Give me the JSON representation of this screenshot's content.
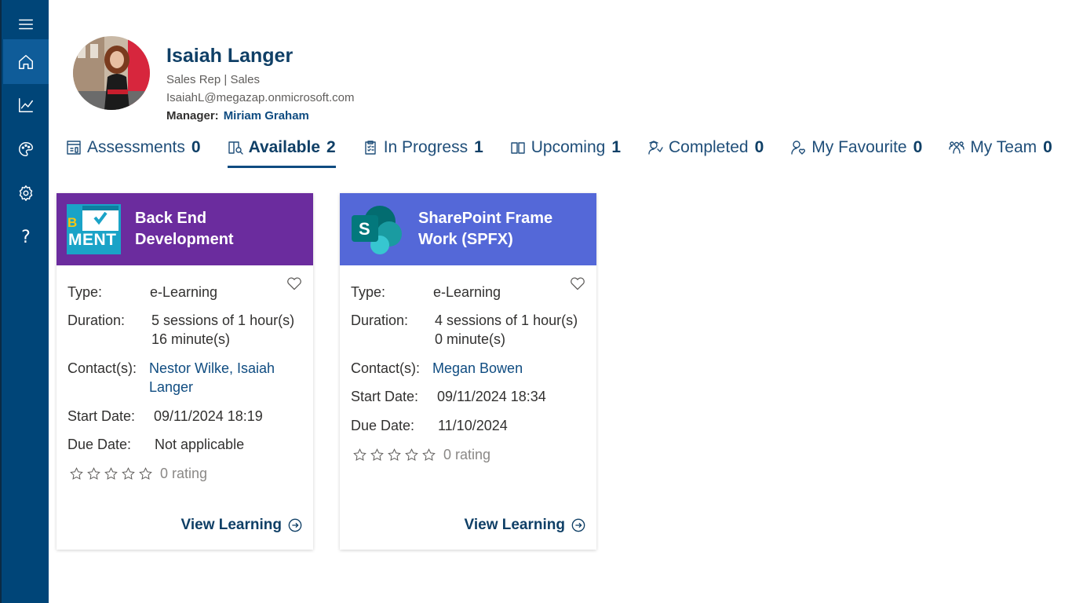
{
  "sidebar": {
    "items": [
      {
        "icon": "hamburger-menu-icon"
      },
      {
        "icon": "home-icon",
        "active": true
      },
      {
        "icon": "chart-line-icon"
      },
      {
        "icon": "palette-icon"
      },
      {
        "icon": "gear-icon"
      },
      {
        "icon": "help-icon",
        "glyph": "?"
      }
    ]
  },
  "profile": {
    "name": "Isaiah Langer",
    "role": "Sales Rep | Sales",
    "email": "IsaiahL@megazap.onmicrosoft.com",
    "manager_label": "Manager:",
    "manager_name": "Miriam Graham"
  },
  "tabs": [
    {
      "label": "Assessments",
      "count": "0",
      "icon": "assessment-icon"
    },
    {
      "label": "Available",
      "count": "2",
      "icon": "book-search-icon",
      "active": true
    },
    {
      "label": "In Progress",
      "count": "1",
      "icon": "clipboard-checklist-icon"
    },
    {
      "label": "Upcoming",
      "count": "1",
      "icon": "open-book-icon"
    },
    {
      "label": "Completed",
      "count": "0",
      "icon": "learner-graduate-icon"
    },
    {
      "label": "My Favourite",
      "count": "0",
      "icon": "person-heart-icon"
    },
    {
      "label": "My Team",
      "count": "0",
      "icon": "team-icon"
    }
  ],
  "cards": [
    {
      "title_line1": "Back End",
      "title_line2": "Development",
      "header_color": "#6b2c9e",
      "thumb_text_top": "B",
      "thumb_text": "MENT",
      "type_label": "Type:",
      "type": "e-Learning",
      "duration_label": "Duration:",
      "duration_line1": "5 sessions of 1 hour(s)",
      "duration_line2": "16 minute(s)",
      "contacts_label": "Contact(s):",
      "contacts_line1": "Nestor Wilke, Isaiah",
      "contacts_line2": "Langer",
      "start_label": "Start Date:",
      "start": "09/11/2024 18:19",
      "due_label": "Due Date:",
      "due": "Not applicable",
      "rating_text": "0 rating",
      "stars": 0,
      "cta": "View Learning"
    },
    {
      "title_line1": "SharePoint Frame",
      "title_line2": "Work (SPFX)",
      "header_color": "#5468d8",
      "thumb_letter": "S",
      "type_label": "Type:",
      "type": "e-Learning",
      "duration_label": "Duration:",
      "duration_line1": "4 sessions of 1 hour(s)",
      "duration_line2": "0 minute(s)",
      "contacts_label": "Contact(s):",
      "contacts_line1": "Megan Bowen",
      "start_label": "Start Date:",
      "start": "09/11/2024 18:34",
      "due_label": "Due Date:",
      "due": "11/10/2024",
      "rating_text": "0 rating",
      "stars": 0,
      "cta": "View Learning"
    }
  ]
}
